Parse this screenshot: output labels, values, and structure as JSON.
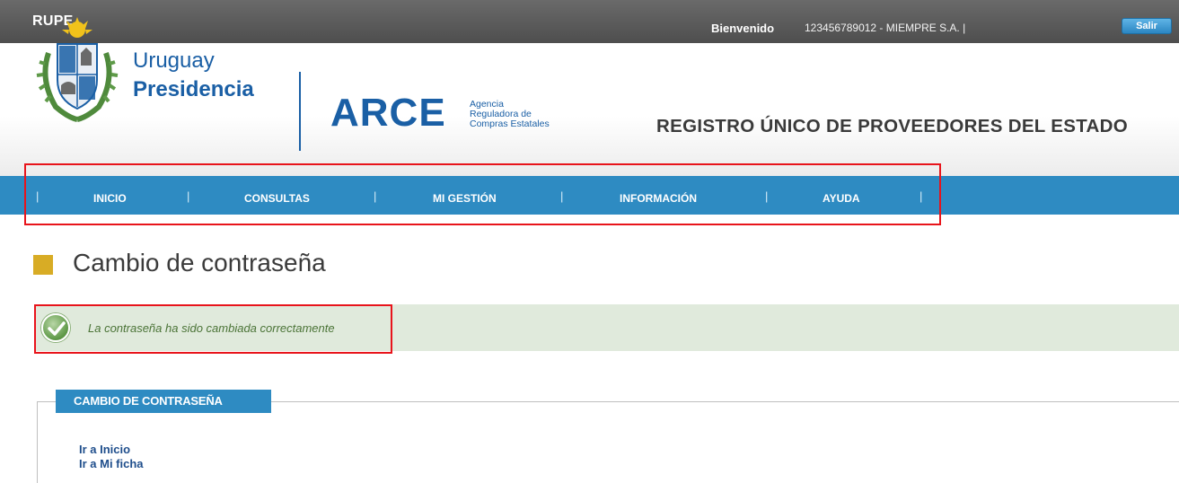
{
  "topbar": {
    "app_name": "RUPE",
    "welcome_label": "Bienvenido",
    "user_info": "123456789012 - MIEMPRE S.A. |",
    "logout_label": "Salir"
  },
  "header": {
    "presidency_line1": "Uruguay",
    "presidency_line2": "Presidencia",
    "arce_logo": "ARCE",
    "arce_sub_line1": "Agencia",
    "arce_sub_line2": "Reguladora de",
    "arce_sub_line3": "Compras Estatales",
    "site_title": "REGISTRO ÚNICO DE PROVEEDORES DEL ESTADO"
  },
  "nav": {
    "items": [
      {
        "label": "INICIO"
      },
      {
        "label": "CONSULTAS"
      },
      {
        "label": "MI GESTIÓN"
      },
      {
        "label": "INFORMACIÓN"
      },
      {
        "label": "AYUDA"
      }
    ],
    "separator": "|"
  },
  "page": {
    "title": "Cambio de contraseña"
  },
  "message": {
    "text": "La contraseña ha sido cambiada correctamente",
    "icon": "check-circle-icon"
  },
  "section": {
    "title": "CAMBIO DE CONTRASEÑA",
    "links": [
      {
        "label": "Ir a Inicio"
      },
      {
        "label": "Ir a Mi ficha"
      }
    ]
  },
  "colors": {
    "nav_bg": "#2e8bc2",
    "highlight": "#e8141b",
    "success_bg": "#e0eadc",
    "title_square": "#d8ac25"
  }
}
